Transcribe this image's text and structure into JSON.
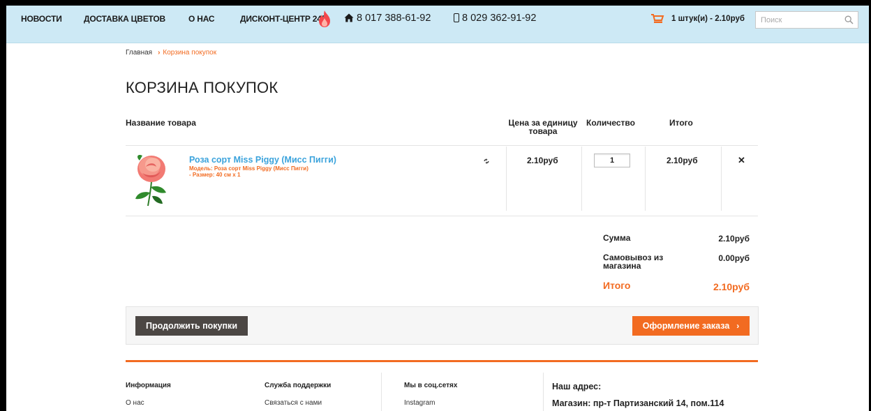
{
  "nav": {
    "items": [
      {
        "label": "НОВОСТИ"
      },
      {
        "label": "ДОСТАВКА ЦВЕТОВ"
      },
      {
        "label": "О НАС"
      },
      {
        "label": "ДИСКОНТ-ЦЕНТР 24/7"
      }
    ],
    "phone_home": "8 017 388-61-92",
    "phone_mobile": "8 029 362-91-92",
    "cart_summary": "1 штук(и) - 2.10руб",
    "search_placeholder": "Поиск"
  },
  "breadcrumb": {
    "home": "Главная",
    "current": "Корзина покупок"
  },
  "page_title": "КОРЗИНА ПОКУПОК",
  "table": {
    "headers": {
      "name": "Название товара",
      "unit_price": "Цена за единицу товара",
      "quantity": "Количество",
      "total": "Итого"
    },
    "rows": [
      {
        "name": "Роза сорт Miss Piggy (Мисс Пигги)",
        "model": "Модель: Роза сорт Miss Piggy (Мисс Пигги)",
        "size": "- Размер: 40 см x 1",
        "unit_price": "2.10руб",
        "quantity": "1",
        "total": "2.10руб"
      }
    ]
  },
  "totals": {
    "subtotal_label": "Сумма",
    "subtotal_value": "2.10руб",
    "pickup_label": "Самовывоз из магазина",
    "pickup_value": "0.00руб",
    "grand_label": "Итого",
    "grand_value": "2.10руб"
  },
  "actions": {
    "continue_label": "Продолжить покупки",
    "checkout_label": "Оформление заказа"
  },
  "footer": {
    "columns": [
      {
        "heading": "Информация",
        "link": "О нас"
      },
      {
        "heading": "Служба поддержки",
        "link": "Связаться с нами"
      },
      {
        "heading": "Мы в соц.сетях",
        "link": "Instagram"
      }
    ],
    "address_heading": "Наш адрес:",
    "address_line": "Магазин: пр-т Партизанский 14, пом.114"
  },
  "colors": {
    "topbar": "#cde9f5",
    "accent": "#f26b21",
    "link": "#3ba3dc",
    "dark_button": "#4c4744"
  },
  "icons": [
    "fire-icon",
    "home-icon",
    "mobile-phone-icon",
    "cart-icon",
    "search-icon",
    "refresh-icon",
    "remove-icon",
    "chevron-right-icon"
  ]
}
